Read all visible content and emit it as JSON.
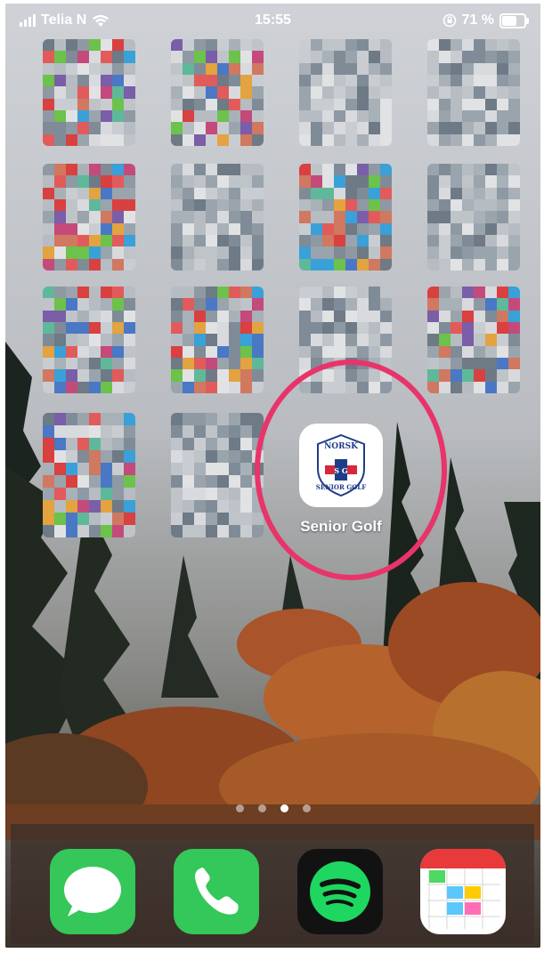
{
  "status_bar": {
    "carrier": "Telia N",
    "time": "15:55",
    "battery_percent": "71 %",
    "battery_level": 0.71
  },
  "highlighted_app": {
    "label": "Senior Golf",
    "logo_top_text": "NORSK",
    "logo_monogram": "S G",
    "logo_bottom_text": "SENIOR GOLF"
  },
  "page_indicator": {
    "pages": 4,
    "current": 3
  },
  "dock": {
    "apps": [
      "messages-icon",
      "phone-icon",
      "spotify-icon",
      "calendar-icon"
    ]
  },
  "colors": {
    "highlight_ring": "#e8346a",
    "messages_green": "#35c759",
    "phone_green": "#34c759",
    "spotify_green": "#1ed760",
    "logo_blue": "#1f3c88",
    "logo_red": "#d6263b"
  }
}
